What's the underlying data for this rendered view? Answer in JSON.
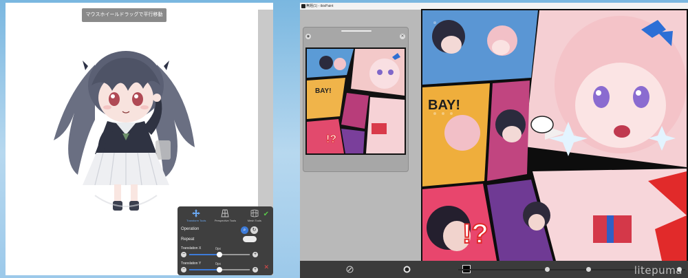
{
  "left_panel": {
    "hint": "マウスホイールドラッグで平行移動",
    "tool_panel": {
      "tabs": [
        {
          "label": "Transform Tools",
          "active": true
        },
        {
          "label": "Perspective Tools",
          "active": false
        },
        {
          "label": "Mesh Tools",
          "active": false
        }
      ],
      "operation_label": "Operation",
      "repeat_label": "Repeat",
      "translation_x_label": "Translation X",
      "translation_x_value": "0px",
      "translation_y_label": "Translation Y",
      "translation_y_value": "0px",
      "slider_x_level": 0.5,
      "slider_y_level": 0.5
    }
  },
  "right_panel": {
    "title": "無題(1) - ibisPaint",
    "watermark": "litepuma"
  },
  "colors": {
    "panel_dark": "#3f3f3f",
    "accent_blue": "#3d7bd9",
    "confirm_green": "#59c74a",
    "cancel_red": "#e04a4a"
  }
}
